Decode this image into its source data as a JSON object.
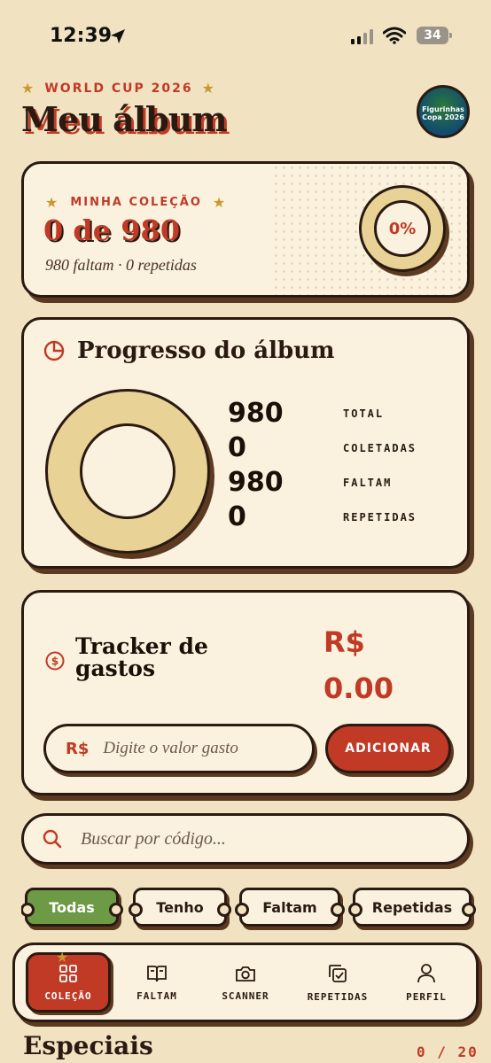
{
  "status_bar": {
    "time": "12:39",
    "battery": "34"
  },
  "header": {
    "eyebrow": "WORLD CUP 2026",
    "title": "Meu álbum",
    "avatar_text": "Figurinhas Copa 2026"
  },
  "collection": {
    "kicker": "MINHA COLEÇÃO",
    "count": "0 de 980",
    "subtitle": "980 faltam · 0 repetidas",
    "percent": "0%",
    "progress_fraction": 0
  },
  "progress": {
    "title": "Progresso do álbum",
    "stats": [
      {
        "value": "980",
        "label": "TOTAL"
      },
      {
        "value": "0",
        "label": "COLETADAS"
      },
      {
        "value": "980",
        "label": "FALTAM"
      },
      {
        "value": "0",
        "label": "REPETIDAS"
      }
    ]
  },
  "tracker": {
    "title": "Tracker de gastos",
    "currency": "R$",
    "amount": "0.00",
    "input_currency": "R$",
    "input_placeholder": "Digite o valor gasto",
    "add_label": "ADICIONAR"
  },
  "search": {
    "placeholder": "Buscar por código..."
  },
  "filters": [
    {
      "label": "Todas",
      "active": true
    },
    {
      "label": "Tenho",
      "active": false
    },
    {
      "label": "Faltam",
      "active": false
    },
    {
      "label": "Repetidas",
      "active": false
    }
  ],
  "nav": [
    {
      "label": "COLEÇÃO",
      "icon": "grid-icon",
      "active": true
    },
    {
      "label": "FALTAM",
      "icon": "book-icon",
      "active": false
    },
    {
      "label": "SCANNER",
      "icon": "camera-icon",
      "active": false
    },
    {
      "label": "REPETIDAS",
      "icon": "copy-check-icon",
      "active": false
    },
    {
      "label": "PERFIL",
      "icon": "user-icon",
      "active": false
    }
  ],
  "specials": {
    "title": "Especiais",
    "count": "0 / 20"
  },
  "colors": {
    "background": "#f1e3c2",
    "card": "#faf2de",
    "accent_red": "#c03a26",
    "accent_green": "#6d9a44",
    "ink": "#2a1a12",
    "gold": "#c8992e",
    "ring_fill": "#e8d296"
  }
}
